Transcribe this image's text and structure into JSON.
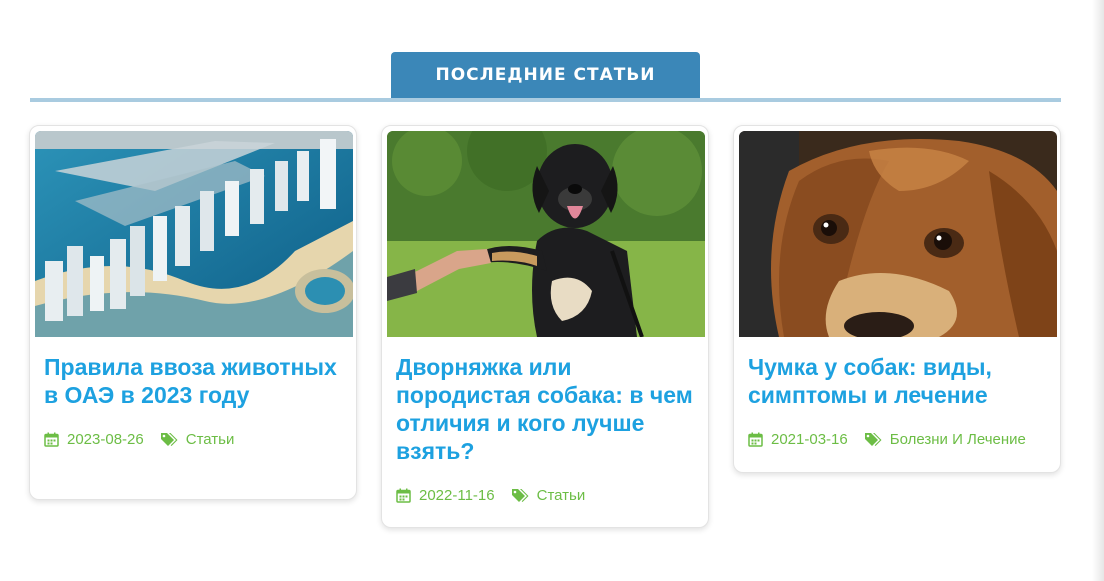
{
  "section": {
    "title": "ПОСЛЕДНИЕ СТАТЬИ"
  },
  "colors": {
    "tab_bg": "#3b87b8",
    "tab_line": "#a9cbe0",
    "title_link": "#1da1e0",
    "meta_green": "#6cbd45"
  },
  "articles": [
    {
      "title": "Правила ввоза животных в ОАЭ в 2023 году",
      "date": "2023-08-26",
      "category": "Статьи",
      "image": "dubai-marina-aerial-photo"
    },
    {
      "title": "Дворняжка или породистая собака: в чем отличия и кого лучше взять?",
      "date": "2022-11-16",
      "category": "Статьи",
      "image": "black-dog-giving-paw-photo"
    },
    {
      "title": "Чумка у собак: виды, симптомы и лечение",
      "date": "2021-03-16",
      "category": "Болезни И Лечение",
      "image": "sad-beagle-closeup-photo"
    }
  ],
  "icons": {
    "date": "calendar-icon",
    "category": "tags-icon"
  }
}
